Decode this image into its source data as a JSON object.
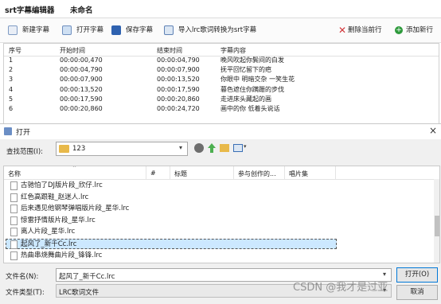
{
  "app": {
    "title": "srt字幕编辑器",
    "document": "未命名"
  },
  "toolbar": {
    "new": "新建字幕",
    "open": "打开字幕",
    "save": "保存字幕",
    "import_lrc": "导入lrc歌词转换为srt字幕",
    "delete_row": "删除当前行",
    "add_row": "添加新行"
  },
  "grid": {
    "headers": [
      "序号",
      "开始时间",
      "结束时间",
      "字幕内容"
    ],
    "rows": [
      [
        "1",
        "00:00:00,470",
        "00:00:04,790",
        "晚风吹起你鬓间的白发"
      ],
      [
        "2",
        "00:00:04,790",
        "00:00:07,900",
        "抚平回忆留下的疤"
      ],
      [
        "3",
        "00:00:07,900",
        "00:00:13,520",
        "你眼中  明暗交杂  一笑生花"
      ],
      [
        "4",
        "00:00:13,520",
        "00:00:17,590",
        "暮色遮住你蹒跚的步伐"
      ],
      [
        "5",
        "00:00:17,590",
        "00:00:20,860",
        "走进床头藏起的画"
      ],
      [
        "6",
        "00:00:20,860",
        "00:00:24,720",
        "画中的你  低着头说话"
      ]
    ]
  },
  "dialog": {
    "title": "打开",
    "lookin_label": "查找范围(I):",
    "lookin_value": "123",
    "columns": [
      "名称",
      "#",
      "标题",
      "参与创作的...",
      "唱片集"
    ],
    "files": [
      "古驰怕了DJ版片段_欣仔.lrc",
      "红色高跟鞋_赵迷人.lrc",
      "后来遇见他钢琴弹唱版片段_星华.lrc",
      "惊雷抒情版片段_星华.lrc",
      "离人片段_星华.lrc",
      "起风了_新千Cc.lrc",
      "热曲串烧舞曲片段_锋锋.lrc"
    ],
    "selected_index": 5,
    "filename_label": "文件名(N):",
    "filename_value": "起风了_新千Cc.lrc",
    "filetype_label": "文件类型(T):",
    "filetype_value": "LRC歌词文件",
    "open_button": "打开(O)",
    "cancel_button": "取消",
    "close_glyph": "×"
  },
  "watermark": "CSDN @我才是过亚",
  "colors": {
    "titlebar_accent": "#d13438",
    "selected_row": "#cce8ff",
    "selected_border": "#99d1ff",
    "folder_yellow": "#e8b94a"
  }
}
